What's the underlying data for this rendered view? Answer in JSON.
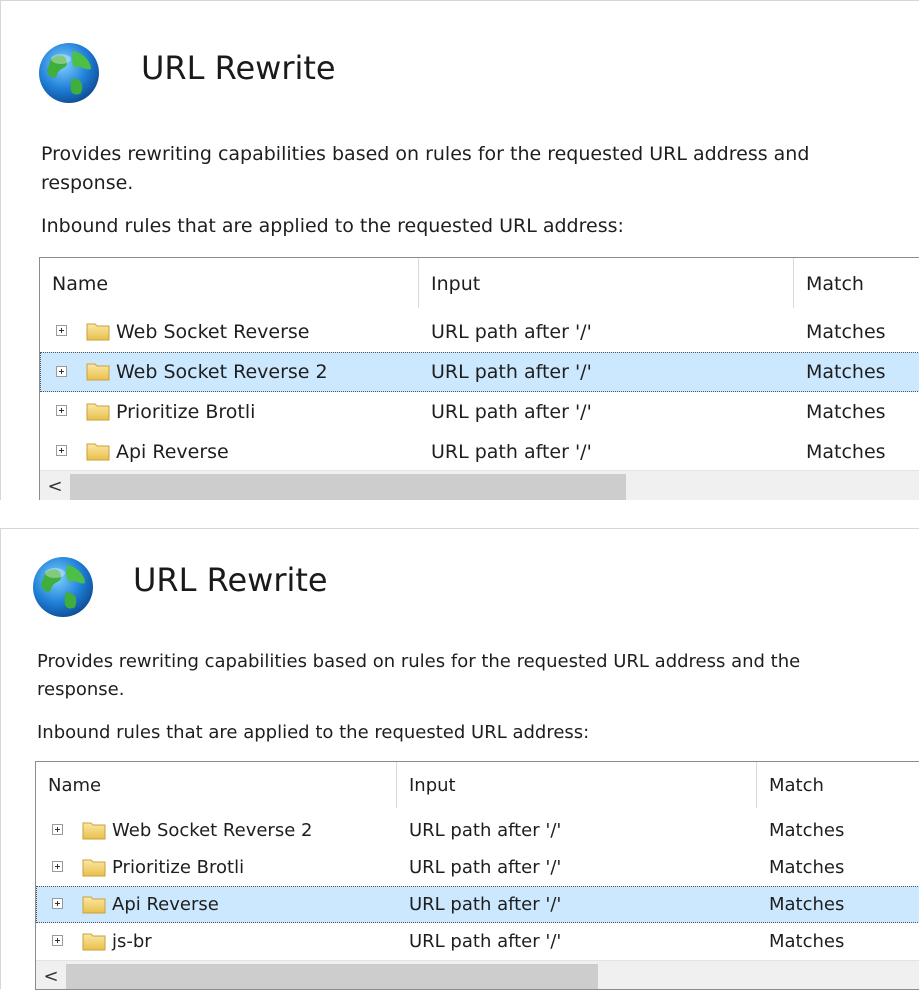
{
  "panels": [
    {
      "title": "URL Rewrite",
      "description_line1": "Provides rewriting capabilities based on rules for the requested URL address and",
      "description_line2": "response.",
      "subtitle": "Inbound rules that are applied to the requested URL address:",
      "columns": [
        "Name",
        "Input",
        "Match"
      ],
      "rows": [
        {
          "name": "Web Socket Reverse",
          "input": "URL path after '/'",
          "match": "Matches",
          "selected": false
        },
        {
          "name": "Web Socket Reverse 2",
          "input": "URL path after '/'",
          "match": "Matches",
          "selected": true
        },
        {
          "name": "Prioritize Brotli",
          "input": "URL path after '/'",
          "match": "Matches",
          "selected": false
        },
        {
          "name": "Api Reverse",
          "input": "URL path after '/'",
          "match": "Matches",
          "selected": false
        }
      ],
      "scroll_left": "<"
    },
    {
      "title": "URL Rewrite",
      "description_line1": "Provides rewriting capabilities based on rules for the requested URL address and the",
      "description_line2": "response.",
      "subtitle": "Inbound rules that are applied to the requested URL address:",
      "columns": [
        "Name",
        "Input",
        "Match"
      ],
      "rows": [
        {
          "name": "Web Socket Reverse 2",
          "input": "URL path after '/'",
          "match": "Matches",
          "selected": false
        },
        {
          "name": "Prioritize Brotli",
          "input": "URL path after '/'",
          "match": "Matches",
          "selected": false
        },
        {
          "name": "Api Reverse",
          "input": "URL path after '/'",
          "match": "Matches",
          "selected": true
        },
        {
          "name": "js-br",
          "input": "URL path after '/'",
          "match": "Matches",
          "selected": false
        }
      ],
      "scroll_left": "<"
    }
  ],
  "colors": {
    "selection": "#cce8ff",
    "folder": "#f4d36a",
    "border": "#8c8c8c"
  },
  "icons": {
    "header": "globe-icon",
    "row": "folder-icon",
    "expand": "expand-plus-icon"
  }
}
